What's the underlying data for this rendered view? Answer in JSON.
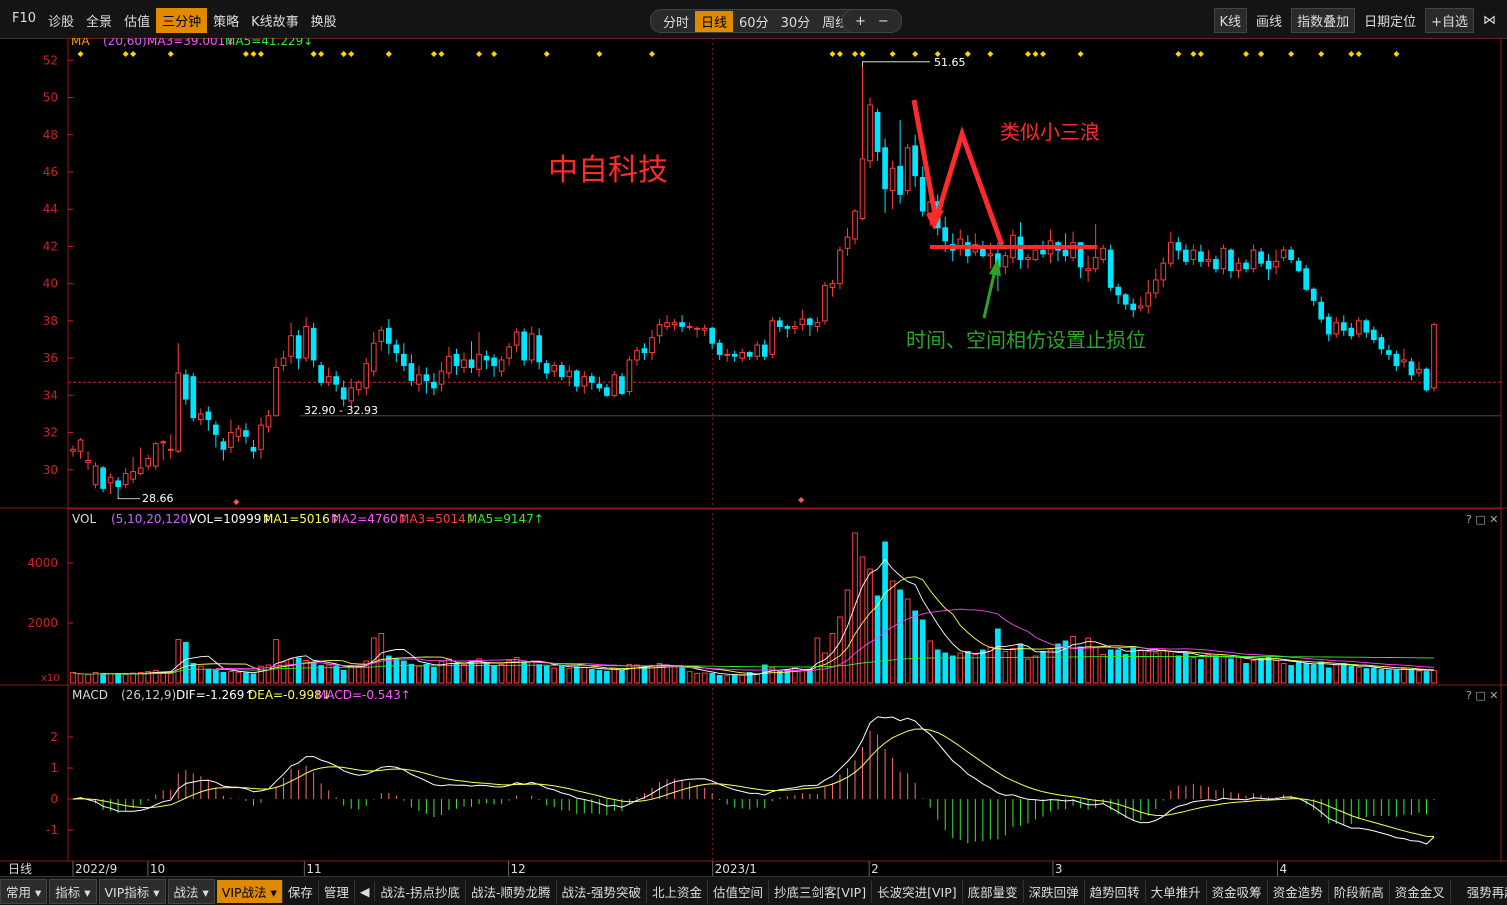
{
  "toolbar": {
    "left": [
      "F10",
      "诊股",
      "全景",
      "估值",
      "三分钟",
      "策略",
      "K线故事",
      "换股"
    ],
    "left_active": 4,
    "periods": [
      "分时",
      "日线",
      "60分",
      "30分",
      "周线"
    ],
    "period_active": 1,
    "period_more": "▾",
    "zoom_in": "+",
    "zoom_out": "−",
    "right": [
      "K线",
      "画线",
      "指数叠加",
      "日期定位",
      "+自选"
    ],
    "right_end": "⋈"
  },
  "main_panel": {
    "indicator": "MA",
    "params": "(20,60)",
    "ma3": "MA3=39.001↓",
    "ma5": "MA5=41.229↓",
    "high_label": "51.65",
    "low_label": "28.66",
    "range_label": "32.90 - 32.93",
    "annotation_title": "中自科技",
    "annotation_wave": "类似小三浪",
    "annotation_stop": "时间、空间相仿设置止损位"
  },
  "vol_panel": {
    "indicator": "VOL",
    "params": "(5,10,20,120)",
    "vol": "VOL=10999↑",
    "ma1": "MA1=5016↑",
    "ma2": "MA2=4760↑",
    "ma3": "MA3=5014↑",
    "ma5": "MA5=9147↑",
    "unit": "x10"
  },
  "macd_panel": {
    "indicator": "MACD",
    "params": "(26,12,9)",
    "dif": "DIF=-1.269↑",
    "dea": "DEA=-0.998↓",
    "macd": "MACD=-0.543↑"
  },
  "panel_controls": "? □ ✕",
  "xaxis_prefix": "日线",
  "colors": {
    "up": "#ff3c3c",
    "down": "#00e5ff",
    "white": "#ffffff",
    "yellow": "#ffff55",
    "magenta": "#ff44ff",
    "green": "#33ee33",
    "axis": "#cc2222",
    "annot_red": "#ff2a2a",
    "annot_green": "#2aa52a"
  },
  "chart_data": [
    {
      "type": "candlestick",
      "name": "price",
      "ylim": [
        28,
        52.5
      ],
      "y_ticks": [
        30,
        32,
        34,
        36,
        38,
        40,
        42,
        44,
        46,
        48,
        50,
        52
      ],
      "x_ticks": [
        "2022/9",
        "10",
        "11",
        "12",
        "2023/1",
        "2",
        "3",
        "4"
      ],
      "current_price_line": 34.7,
      "support_line": 32.9,
      "candles": [
        [
          31,
          31.1,
          30.7,
          31.3
        ],
        [
          31,
          31.6,
          30.6,
          31.7
        ],
        [
          30.4,
          30.5,
          30,
          31
        ],
        [
          29.2,
          30.2,
          29,
          30.4
        ],
        [
          30.1,
          29,
          28.8,
          30.2
        ],
        [
          29.3,
          29.6,
          28.7,
          29.8
        ],
        [
          29.4,
          29.1,
          28.66,
          29.6
        ],
        [
          29.2,
          29.8,
          29,
          30.1
        ],
        [
          29.5,
          29.9,
          29.3,
          30.7
        ],
        [
          29.8,
          30.1,
          29.7,
          31.2
        ],
        [
          30.2,
          30.6,
          30,
          30.8
        ],
        [
          30.2,
          31.4,
          30,
          31.5
        ],
        [
          31.5,
          31.5,
          30.5,
          31.6
        ],
        [
          31.1,
          31.1,
          30.6,
          31.9
        ],
        [
          31,
          35.2,
          30.9,
          36.8
        ],
        [
          35.1,
          33.8,
          33.5,
          35.4
        ],
        [
          35,
          32.8,
          32.6,
          35.2
        ],
        [
          32.7,
          33,
          32.4,
          33.3
        ],
        [
          33.1,
          32.7,
          32.1,
          33.4
        ],
        [
          32.4,
          31.9,
          31.2,
          32.6
        ],
        [
          31.5,
          31.1,
          30.5,
          31.7
        ],
        [
          31.2,
          32,
          30.9,
          32.7
        ],
        [
          31.8,
          32.2,
          31.5,
          32.4
        ],
        [
          32.1,
          31.8,
          31.4,
          32.5
        ],
        [
          31.2,
          31,
          30.6,
          31.6
        ],
        [
          31.1,
          32.4,
          30.6,
          32.8
        ],
        [
          32.3,
          32.9,
          32,
          33.2
        ],
        [
          32.9,
          35.5,
          32.9,
          36
        ],
        [
          35.6,
          36,
          35.3,
          36.4
        ],
        [
          36.1,
          37.2,
          35.7,
          37.9
        ],
        [
          37.2,
          36,
          35.4,
          37.5
        ],
        [
          36,
          37.7,
          35.8,
          38.2
        ],
        [
          37.6,
          35.9,
          35.5,
          37.9
        ],
        [
          35.6,
          34.7,
          34.5,
          35.8
        ],
        [
          34.7,
          35,
          34.5,
          35.5
        ],
        [
          35,
          34.6,
          34.2,
          35.3
        ],
        [
          34.4,
          33.8,
          33.4,
          34.8
        ],
        [
          33.7,
          34.4,
          33.3,
          34.9
        ],
        [
          34.3,
          34.7,
          34,
          34.8
        ],
        [
          34.4,
          35.7,
          34,
          36
        ],
        [
          35.3,
          36.8,
          35,
          37.4
        ],
        [
          36.9,
          37.5,
          36.4,
          37.7
        ],
        [
          37.6,
          36.8,
          36.2,
          38.1
        ],
        [
          36.7,
          36.3,
          35.8,
          37
        ],
        [
          36.2,
          35.6,
          35.3,
          36.8
        ],
        [
          35.7,
          34.8,
          34.5,
          36.2
        ],
        [
          34.6,
          35.1,
          34.2,
          35.6
        ],
        [
          35.1,
          34.8,
          34.1,
          35.5
        ],
        [
          34.7,
          34.4,
          34,
          35.2
        ],
        [
          34.6,
          35.3,
          34.2,
          35.8
        ],
        [
          35.2,
          36.1,
          34.9,
          36.6
        ],
        [
          36.2,
          35.6,
          35.1,
          36.5
        ],
        [
          35.5,
          35.9,
          35.2,
          36.3
        ],
        [
          35.9,
          35.5,
          35.2,
          36.9
        ],
        [
          35.4,
          36.2,
          35,
          37.4
        ],
        [
          36.1,
          35.9,
          35.4,
          36.4
        ],
        [
          36,
          35.6,
          35,
          36.2
        ],
        [
          35.3,
          35.9,
          35,
          36.1
        ],
        [
          36,
          36.6,
          35.6,
          36.8
        ],
        [
          36.7,
          37.4,
          36.3,
          37.6
        ],
        [
          37.4,
          35.9,
          35.6,
          37.6
        ],
        [
          35.9,
          37.3,
          35.7,
          37.7
        ],
        [
          37.2,
          35.8,
          35.4,
          37.6
        ],
        [
          35.7,
          35.2,
          34.9,
          35.9
        ],
        [
          35.3,
          35.6,
          35,
          35.8
        ],
        [
          35.6,
          35,
          34.8,
          35.8
        ],
        [
          35,
          35.3,
          34.5,
          35.6
        ],
        [
          35.3,
          34.5,
          34.2,
          35.4
        ],
        [
          34.5,
          35,
          34.1,
          35.3
        ],
        [
          35,
          34.7,
          34.3,
          35.2
        ],
        [
          34.6,
          34.4,
          34.2,
          35
        ],
        [
          34.4,
          34,
          33.9,
          34.6
        ],
        [
          34,
          35.1,
          33.9,
          35.3
        ],
        [
          35,
          34.1,
          34,
          35.2
        ],
        [
          34.2,
          35.9,
          34,
          36.1
        ],
        [
          35.9,
          36.4,
          35.6,
          36.6
        ],
        [
          36.5,
          36.3,
          35.9,
          36.8
        ],
        [
          36.3,
          37.1,
          35.9,
          37.5
        ],
        [
          37.2,
          37.8,
          36.8,
          38.1
        ],
        [
          37.7,
          37.9,
          37.5,
          38.3
        ],
        [
          37.8,
          37.9,
          37.5,
          38.1
        ],
        [
          37.9,
          37.7,
          37.4,
          38.3
        ],
        [
          37.7,
          37.7,
          37.5,
          37.9
        ],
        [
          37.6,
          37.6,
          37.1,
          37.7
        ],
        [
          37.5,
          37.6,
          37.2,
          37.8
        ],
        [
          37.6,
          36.8,
          36.5,
          37.7
        ],
        [
          36.8,
          36.2,
          35.9,
          37
        ],
        [
          36.2,
          36.2,
          35.8,
          36.5
        ],
        [
          36.2,
          36.1,
          35.8,
          36.4
        ],
        [
          36,
          36.3,
          35.8,
          36.5
        ],
        [
          36.3,
          36.1,
          35.9,
          36.4
        ],
        [
          36.1,
          36.7,
          35.9,
          36.9
        ],
        [
          36.7,
          36.1,
          35.9,
          37
        ],
        [
          36.2,
          38,
          36,
          38.2
        ],
        [
          38,
          37.7,
          37.4,
          38.2
        ],
        [
          37.7,
          37.6,
          37.1,
          37.8
        ],
        [
          37.6,
          37.7,
          37.3,
          38
        ],
        [
          37.8,
          38.1,
          37.5,
          38.6
        ],
        [
          38.1,
          37.8,
          37.2,
          38.2
        ],
        [
          37.7,
          37.9,
          37.4,
          38.2
        ],
        [
          38,
          39.9,
          37.8,
          40.1
        ],
        [
          39.8,
          40,
          39.3,
          40.2
        ],
        [
          40,
          41.8,
          39.7,
          42
        ],
        [
          41.9,
          42.5,
          41.5,
          43
        ],
        [
          42.4,
          43.9,
          42.1,
          44
        ],
        [
          43.5,
          46.7,
          43.4,
          51.65
        ],
        [
          46.6,
          49.6,
          46.2,
          50
        ],
        [
          49.2,
          47.1,
          46.6,
          49.4
        ],
        [
          47.3,
          45.1,
          43.8,
          47.8
        ],
        [
          45,
          46.2,
          44,
          46.6
        ],
        [
          46.3,
          44.8,
          44.3,
          48.8
        ],
        [
          45,
          47.3,
          44.8,
          47.5
        ],
        [
          47.4,
          45.8,
          45.2,
          48
        ],
        [
          45.7,
          43.9,
          43.6,
          46.3
        ],
        [
          43.8,
          44.4,
          43.1,
          45.1
        ],
        [
          44.4,
          43,
          42.6,
          44.8
        ],
        [
          43,
          42.3,
          41.7,
          43.6
        ],
        [
          42.1,
          41.8,
          41.2,
          42.7
        ],
        [
          41.9,
          42.4,
          41.5,
          42.9
        ],
        [
          42.2,
          41.5,
          41.1,
          42.6
        ],
        [
          41.7,
          42.1,
          41.5,
          42.7
        ],
        [
          42,
          41.5,
          41.4,
          42.3
        ],
        [
          41.5,
          41.6,
          40.8,
          42.2
        ],
        [
          41.6,
          40.9,
          39.6,
          42.2
        ],
        [
          40.9,
          41.5,
          40.5,
          41.7
        ],
        [
          41.4,
          42.6,
          41.1,
          42.9
        ],
        [
          42.5,
          41.3,
          40.8,
          43.3
        ],
        [
          41.3,
          41.4,
          40.8,
          41.6
        ],
        [
          41.3,
          41.8,
          41.2,
          42.1
        ],
        [
          41.8,
          41.6,
          41.4,
          42.3
        ],
        [
          41.6,
          42.3,
          41.1,
          42.9
        ],
        [
          42.2,
          41.8,
          41.2,
          42.3
        ],
        [
          41.8,
          41.5,
          41.2,
          42.7
        ],
        [
          41.4,
          42.2,
          41.2,
          42.8
        ],
        [
          42.2,
          40.9,
          40.3,
          42.2
        ],
        [
          40.7,
          40.8,
          40.1,
          41.5
        ],
        [
          40.8,
          41.4,
          40.6,
          43.2
        ],
        [
          41.3,
          41.9,
          41.1,
          42.1
        ],
        [
          41.8,
          39.8,
          39.6,
          42.1
        ],
        [
          39.8,
          39.4,
          38.9,
          40
        ],
        [
          39.4,
          38.9,
          38.6,
          39.5
        ],
        [
          38.9,
          38.6,
          38.2,
          39.2
        ],
        [
          38.7,
          38.8,
          38.5,
          39.3
        ],
        [
          38.8,
          39.5,
          38.4,
          40.2
        ],
        [
          39.5,
          40.2,
          39.2,
          40.8
        ],
        [
          40.2,
          41.1,
          39.8,
          41.4
        ],
        [
          41.1,
          42.2,
          40.9,
          42.8
        ],
        [
          42.2,
          41.8,
          41.3,
          42.5
        ],
        [
          41.8,
          41.2,
          41,
          42.1
        ],
        [
          41.3,
          41.8,
          41,
          42.1
        ],
        [
          41.7,
          41.2,
          40.9,
          42.1
        ],
        [
          41.2,
          41.3,
          40.9,
          41.8
        ],
        [
          41.3,
          40.8,
          40.6,
          41.5
        ],
        [
          40.8,
          41.9,
          40.5,
          42.1
        ],
        [
          41.8,
          40.7,
          40.3,
          41.9
        ],
        [
          40.7,
          41.1,
          40.3,
          41.4
        ],
        [
          41.1,
          40.8,
          40.6,
          41.3
        ],
        [
          40.8,
          41.8,
          40.6,
          42.1
        ],
        [
          41.7,
          41.1,
          40.9,
          41.9
        ],
        [
          41.2,
          40.8,
          40.2,
          41.6
        ],
        [
          40.9,
          41.2,
          40.5,
          41.8
        ],
        [
          41.4,
          41.8,
          41.2,
          42
        ],
        [
          41.8,
          41.3,
          41.1,
          42
        ],
        [
          41.2,
          40.7,
          40.6,
          41.4
        ],
        [
          40.8,
          39.7,
          39.6,
          41
        ],
        [
          39.7,
          39.1,
          38.8,
          39.8
        ],
        [
          39,
          38.1,
          37.9,
          39.3
        ],
        [
          38.2,
          37.3,
          36.9,
          38.4
        ],
        [
          37.3,
          37.9,
          37.1,
          38.2
        ],
        [
          37.9,
          37.5,
          37.2,
          38.3
        ],
        [
          37.6,
          37.2,
          37,
          37.9
        ],
        [
          37.3,
          38,
          37.1,
          38.2
        ],
        [
          38,
          37.4,
          37.1,
          38.1
        ],
        [
          37.5,
          37,
          36.8,
          37.7
        ],
        [
          37.1,
          36.5,
          36.2,
          37.3
        ],
        [
          36.4,
          36.2,
          35.9,
          36.7
        ],
        [
          36.2,
          35.6,
          35.3,
          36.4
        ],
        [
          35.8,
          35.9,
          35.5,
          36.5
        ],
        [
          35.8,
          35.1,
          34.8,
          36
        ],
        [
          35.2,
          35.4,
          35,
          35.8
        ],
        [
          35.4,
          34.3,
          34.2,
          35.5
        ],
        [
          34.4,
          37.8,
          34.2,
          37.9
        ]
      ]
    },
    {
      "type": "bar",
      "name": "volume",
      "ylim": [
        0,
        5100
      ],
      "y_ticks": [
        2000,
        4000
      ],
      "values": [
        350,
        300,
        280,
        350,
        320,
        300,
        310,
        280,
        330,
        350,
        380,
        420,
        350,
        380,
        1450,
        1350,
        650,
        560,
        460,
        420,
        350,
        380,
        360,
        330,
        300,
        560,
        600,
        1450,
        700,
        800,
        830,
        750,
        670,
        580,
        600,
        560,
        420,
        560,
        560,
        730,
        1500,
        1650,
        900,
        800,
        730,
        620,
        560,
        620,
        520,
        720,
        800,
        640,
        620,
        730,
        800,
        650,
        560,
        620,
        750,
        850,
        700,
        720,
        610,
        560,
        500,
        560,
        480,
        540,
        520,
        450,
        420,
        390,
        500,
        430,
        620,
        600,
        520,
        590,
        650,
        600,
        540,
        500,
        380,
        320,
        330,
        320,
        250,
        240,
        260,
        270,
        350,
        300,
        600,
        500,
        400,
        450,
        500,
        430,
        460,
        1500,
        1000,
        1650,
        2200,
        3100,
        5000,
        4200,
        3800,
        2900,
        4700,
        3400,
        3100,
        2800,
        2400,
        2100,
        1400,
        1100,
        1000,
        900,
        1000,
        1050,
        950,
        1100,
        1200,
        1800,
        1050,
        1150,
        1300,
        800,
        900,
        1050,
        1100,
        1300,
        1400,
        1550,
        1200,
        1500,
        1200,
        950,
        1100,
        1100,
        950,
        1200,
        1100,
        1050,
        1000,
        1100,
        1050,
        900,
        1000,
        850,
        780,
        950,
        900,
        900,
        800,
        850,
        650,
        750,
        800,
        850,
        750,
        650,
        580,
        700,
        650,
        600,
        700,
        500,
        600,
        650,
        550,
        520,
        480,
        500,
        450,
        430,
        420,
        480,
        450,
        400,
        380,
        420,
        1050
      ]
    },
    {
      "type": "bar+line",
      "name": "macd",
      "ylim": [
        -1.9,
        3.0
      ],
      "y_ticks": [
        -1,
        0,
        1,
        2
      ]
    }
  ]
}
